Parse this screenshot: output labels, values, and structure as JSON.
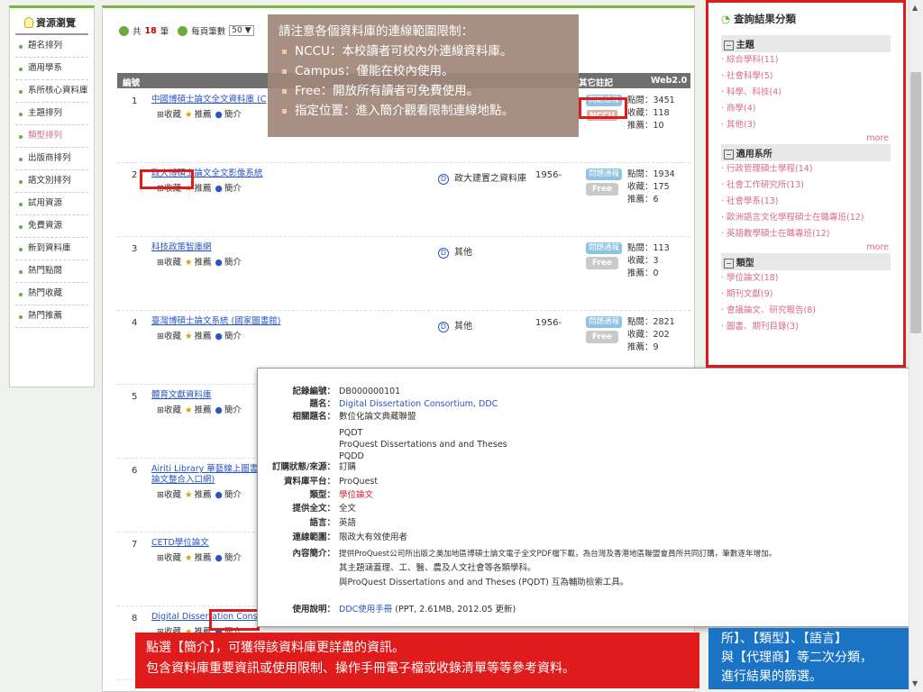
{
  "sidebar": {
    "title": "資源瀏覽",
    "items": [
      "題名排列",
      "適用學系",
      "系所核心資料庫",
      "主題排列",
      "類型排列",
      "出版商排列",
      "語文別排列",
      "試用資源",
      "免費資源",
      "新到資料庫",
      "熱門點閱",
      "熱門收藏",
      "熱門推薦"
    ]
  },
  "toolbar": {
    "total_prefix": "共",
    "total_count": "18",
    "total_suffix": "筆",
    "per_page_label": "每頁筆數",
    "per_page_value": "50"
  },
  "table": {
    "headers": {
      "no": "編號",
      "notes": "其它註記",
      "web20": "Web2.0"
    }
  },
  "action_labels": {
    "collect": "收藏",
    "recommend": "推薦",
    "intro": "簡介"
  },
  "stat_labels": {
    "clicks": "點閱：",
    "collects": "收藏：",
    "recommends": "推薦："
  },
  "rows": [
    {
      "no": "1",
      "title": "中國博碩士論文全文資料庫 (C",
      "badge_q": "問題通報",
      "badge_f": "NCCU",
      "clicks": "3451",
      "collects": "118",
      "recommends": "10"
    },
    {
      "no": "2",
      "title": "政大博碩士論文全文影像系統",
      "d": "政大建置之資料庫",
      "year": "1956-",
      "badge_q": "問題通報",
      "badge_f": "Free",
      "clicks": "1934",
      "collects": "175",
      "recommends": "6"
    },
    {
      "no": "3",
      "title": "科技政策智庫網",
      "d": "其他",
      "badge_q": "問題通報",
      "badge_f": "Free",
      "clicks": "113",
      "collects": "3",
      "recommends": "0"
    },
    {
      "no": "4",
      "title": "臺灣博碩士論文系統 (國家圖書館)",
      "d": "其他",
      "year": "1956-",
      "badge_q": "問題通報",
      "badge_f": "Free",
      "clicks": "2821",
      "collects": "202",
      "recommends": "9"
    },
    {
      "no": "5",
      "title": "體育文獻資料庫"
    },
    {
      "no": "6",
      "title": "Airiti Library 華藝線上圖書館",
      "title2": "論文整合入口網)"
    },
    {
      "no": "7",
      "title": "CETD學位論文"
    },
    {
      "no": "8",
      "title": "Digital Dissertation Cons"
    }
  ],
  "callout1": {
    "heading": "請注意各個資料庫的連線範圍限制：",
    "bullets": [
      "NCCU：本校讀者可校內外連線資料庫。",
      "Campus：僅能在校內使用。",
      "Free：開放所有讀者可免費使用。",
      "指定位置：進入簡介觀看限制連線地點。"
    ]
  },
  "right": {
    "title": "查詢結果分類",
    "more": "more",
    "sec1": "主題",
    "sec1_items": [
      "綜合學科(11)",
      "社會科學(5)",
      "科學、科技(4)",
      "商學(4)",
      "其他(3)"
    ],
    "sec2": "適用系所",
    "sec2_items": [
      "行政管理碩士學程(14)",
      "社會工作研究所(13)",
      "社會學系(13)",
      "歐洲語言文化學程碩士在職專班(12)",
      "英語教學碩士在職專班(12)"
    ],
    "sec3": "類型",
    "sec3_items": [
      "學位論文(18)",
      "期刊文獻(9)",
      "會議論文、研究報告(8)",
      "圖書、期刊目錄(3)"
    ]
  },
  "popup": {
    "record_no": {
      "label": "記錄編號：",
      "value": "DB000000101"
    },
    "title": {
      "label": "題名：",
      "value": "Digital Dissertation Consortium, DDC"
    },
    "related": {
      "label": "相關題名：",
      "values": [
        "數位化論文典藏聯盟",
        "PQDT",
        "ProQuest Dissertations and and Theses",
        "PQDD"
      ]
    },
    "status": {
      "label": "訂購狀態/來源：",
      "value": "訂購"
    },
    "platform": {
      "label": "資料庫平台：",
      "value": "ProQuest"
    },
    "type": {
      "label": "類型：",
      "value": "學位論文"
    },
    "fulltext": {
      "label": "提供全文：",
      "value": "全文"
    },
    "lang": {
      "label": "語言：",
      "value": "英語"
    },
    "scope": {
      "label": "連線範圍：",
      "value": "限政大有效使用者"
    },
    "desc": {
      "label": "內容簡介：",
      "values": [
        "提供ProQuest公司所出版之美加地區博碩士論文電子全文PDF檔下載，為台灣及香港地區聯盟會員所共同訂購，筆數逐年增加。",
        "其主題涵蓋理、工、醫、農及人文社會等各類學科。",
        "與ProQuest Dissertations and and Theses (PQDT) 互為輔助檢索工具。"
      ]
    },
    "usage": {
      "label": "使用說明：",
      "link": "DDC使用手冊",
      "suffix": "(PPT, 2.61MB, 2012.05 更新)"
    }
  },
  "callout_red": {
    "line1": "點選【簡介】，可獲得該資料庫更詳盡的資訊。",
    "line2": "包含資料庫重要資訊或使用限制、操作手冊電子檔或收錄清單等等參考資料。"
  },
  "callout_blue": {
    "line1": "所】、【類型】、【語言】",
    "line2": "與【代理商】等二次分類，",
    "line3": "進行結果的篩選。"
  }
}
